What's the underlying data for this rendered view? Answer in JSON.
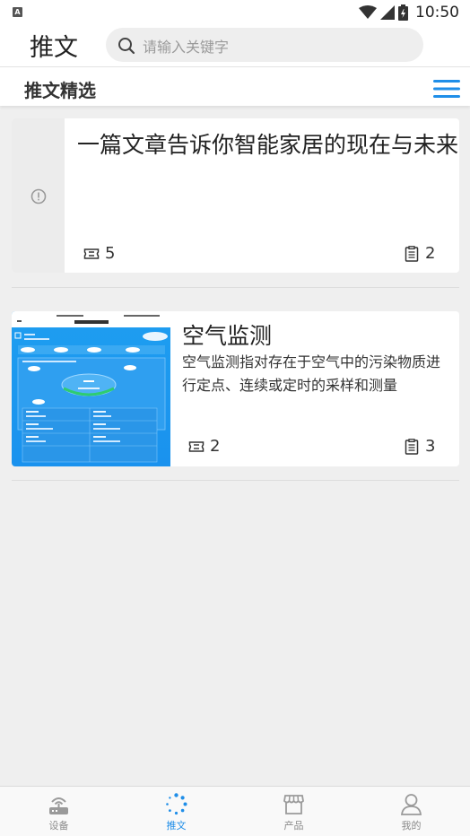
{
  "status_bar": {
    "time": "10:50",
    "app_badge": "A"
  },
  "header": {
    "title": "推文",
    "search": {
      "placeholder": "请输入关键字",
      "icon": "search-icon"
    }
  },
  "section": {
    "title": "推文精选",
    "menu_icon": "hamburger-menu-icon"
  },
  "articles": [
    {
      "title": "一篇文章告诉你智能家居的现在与未来",
      "description": "",
      "comments": "5",
      "reads": "2",
      "thumbnail": "missing-image-alert-icon"
    },
    {
      "title": "空气监测",
      "description": "空气监测指对存在于空气中的污染物质进行定点、连续或定时的采样和测量",
      "comments": "2",
      "reads": "3",
      "thumbnail": "air-monitor-app-screenshot"
    }
  ],
  "bottom_nav": [
    {
      "label": "设备",
      "icon": "router-icon",
      "active": false
    },
    {
      "label": "推文",
      "icon": "loading-spinner-icon",
      "active": true
    },
    {
      "label": "产品",
      "icon": "store-icon",
      "active": false
    },
    {
      "label": "我的",
      "icon": "user-icon",
      "active": false
    }
  ],
  "colors": {
    "accent": "#1f8ee8",
    "background": "#efefef",
    "inactive": "#8a8a8a"
  }
}
